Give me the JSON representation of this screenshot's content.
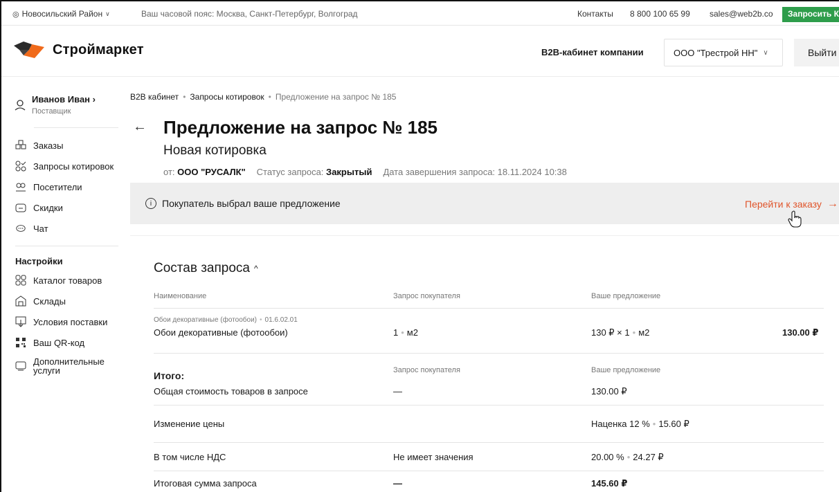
{
  "topbar": {
    "region": "Новосильский Район",
    "timezone": "Ваш часовой пояс: Москва, Санкт-Петербург, Волгоград",
    "contacts": "Контакты",
    "phone": "8 800 100 65 99",
    "email": "sales@web2b.co",
    "request_kp": "Запросить КП"
  },
  "header": {
    "logo": "Строймаркет",
    "cabinet": "B2B-кабинет компании",
    "company": "ООО \"Трестрой НН\"",
    "logout": "Выйти"
  },
  "sidebar": {
    "user_name": "Иванов Иван",
    "user_role": "Поставщик",
    "items": [
      {
        "label": "Заказы",
        "icon": "orders-icon"
      },
      {
        "label": "Запросы котировок",
        "icon": "quotes-icon"
      },
      {
        "label": "Посетители",
        "icon": "visitors-icon"
      },
      {
        "label": "Скидки",
        "icon": "discounts-icon"
      },
      {
        "label": "Чат",
        "icon": "chat-icon"
      }
    ],
    "settings_title": "Настройки",
    "settings_items": [
      {
        "label": "Каталог товаров",
        "icon": "catalog-icon"
      },
      {
        "label": "Склады",
        "icon": "warehouse-icon"
      },
      {
        "label": "Условия поставки",
        "icon": "delivery-icon"
      },
      {
        "label": "Ваш QR-код",
        "icon": "qr-icon"
      },
      {
        "label": "Дополнительные услуги",
        "icon": "services-icon"
      }
    ]
  },
  "breadcrumb": {
    "b1": "B2B кабинет",
    "b2": "Запросы котировок",
    "b3": "Предложение на запрос № 185"
  },
  "page": {
    "title": "Предложение на запрос № 185",
    "subtitle": "Новая котировка",
    "from_label": "от:",
    "from_value": "ООО \"РУСАЛК\"",
    "status_label": "Статус запроса:",
    "status_value": "Закрытый",
    "end_date": "Дата завершения запроса: 18.11.2024 10:38"
  },
  "notice": {
    "text": "Покупатель выбрал ваше предложение",
    "link": "Перейти к заказу"
  },
  "composition": {
    "title": "Состав запроса",
    "headers": {
      "name": "Наименование",
      "buyer": "Запрос покупателя",
      "offer": "Ваше предложение"
    },
    "item": {
      "meta_name": "Обои декоративные (фотообои)",
      "meta_code": "01.6.02.01",
      "name": "Обои декоративные (фотообои)",
      "buyer_qty": "1",
      "buyer_unit": "м2",
      "offer_price": "130 ₽ × 1",
      "offer_unit": "м2",
      "total": "130.00 ₽"
    },
    "totals": {
      "title": "Итого:",
      "buyer_header": "Запрос покупателя",
      "offer_header": "Ваше предложение",
      "rows": [
        {
          "label": "Общая стоимость товаров в запросе",
          "buyer": "—",
          "offer": "130.00 ₽"
        },
        {
          "label": "Изменение цены",
          "buyer": "",
          "offer": "Наценка  12 %",
          "offer2": "15.60 ₽"
        },
        {
          "label": "В том числе НДС",
          "buyer": "Не имеет значения",
          "offer": "20.00 %",
          "offer2": "24.27 ₽"
        },
        {
          "label": "Итоговая сумма запроса",
          "buyer": "—",
          "offer": "145.60 ₽"
        }
      ]
    }
  },
  "colors": {
    "accent_green": "#2e9d4b",
    "link_orange": "#e0542a",
    "logo_orange": "#f06a1b",
    "logo_dark": "#2b2b2b"
  }
}
